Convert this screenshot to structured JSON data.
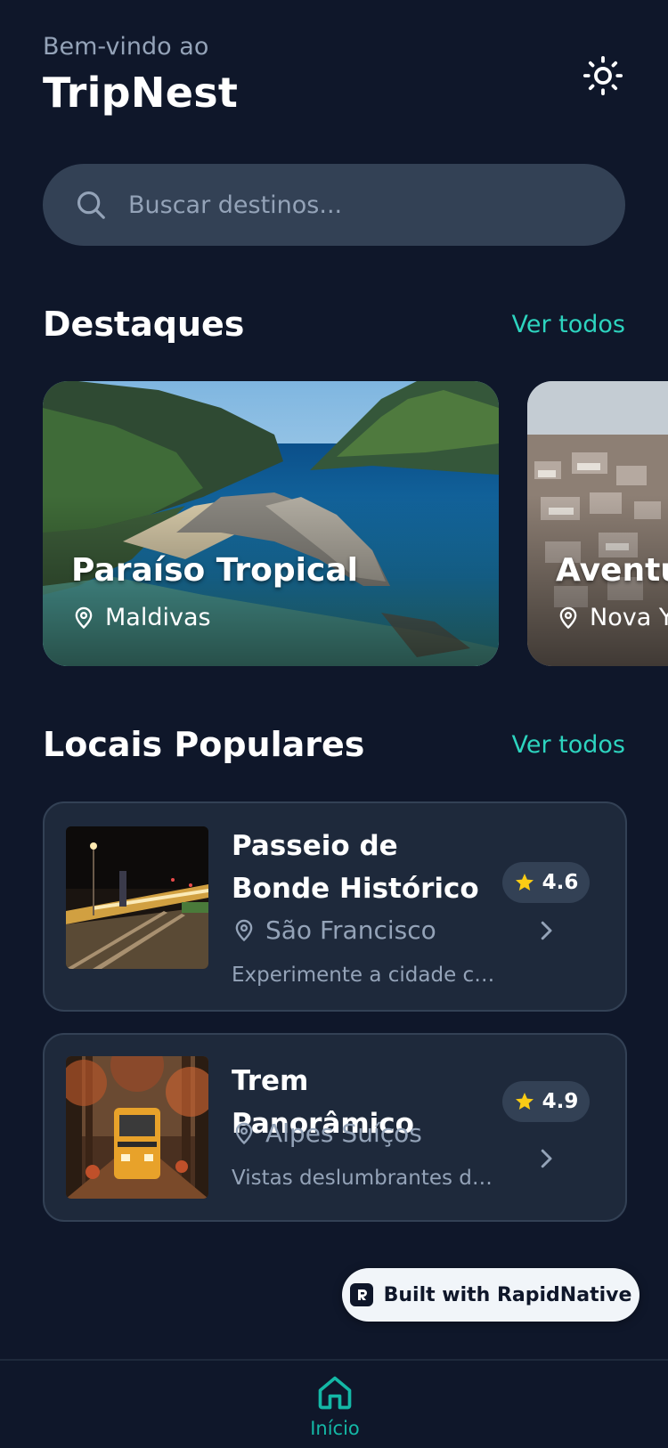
{
  "header": {
    "welcome": "Bem-vindo ao",
    "app_name": "TripNest"
  },
  "search": {
    "placeholder": "Buscar destinos..."
  },
  "featured": {
    "title": "Destaques",
    "see_all": "Ver todos",
    "cards": [
      {
        "title": "Paraíso Tropical",
        "location": "Maldivas"
      },
      {
        "title": "Aventu",
        "location": "Nova Y"
      }
    ]
  },
  "popular": {
    "title": "Locais Populares",
    "see_all": "Ver todos",
    "items": [
      {
        "title": "Passeio de Bonde Histórico",
        "location": "São Francisco",
        "description": "Experimente a cidade co...",
        "rating": "4.6"
      },
      {
        "title": "Trem Panorâmico",
        "location": "Alpes Suíços",
        "description": "Vistas deslumbrantes de ...",
        "rating": "4.9"
      }
    ]
  },
  "badge": {
    "label": "Built with RapidNative"
  },
  "tabbar": {
    "home_label": "Início"
  },
  "colors": {
    "background": "#0f172a",
    "surface": "#1e293b",
    "accent": "#2dd4bf",
    "star": "#facc15"
  }
}
